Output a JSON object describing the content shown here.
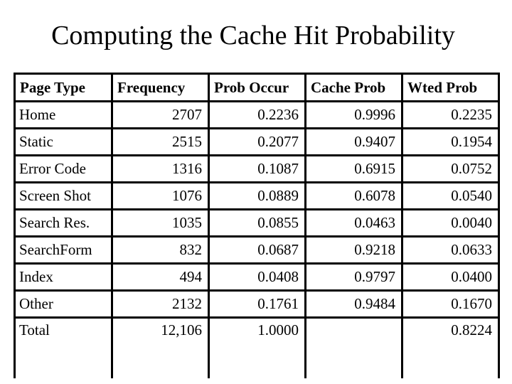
{
  "title": "Computing the Cache Hit Probability",
  "table": {
    "headers": [
      "Page Type",
      "Frequency",
      "Prob Occur",
      "Cache Prob",
      "Wted Prob"
    ],
    "rows": [
      [
        "Home",
        "2707",
        "0.2236",
        "0.9996",
        "0.2235"
      ],
      [
        "Static",
        "2515",
        "0.2077",
        "0.9407",
        "0.1954"
      ],
      [
        "Error Code",
        "1316",
        "0.1087",
        "0.6915",
        "0.0752"
      ],
      [
        "Screen Shot",
        "1076",
        "0.0889",
        "0.6078",
        "0.0540"
      ],
      [
        "Search Res.",
        "1035",
        "0.0855",
        "0.0463",
        "0.0040"
      ],
      [
        "SearchForm",
        "832",
        "0.0687",
        "0.9218",
        "0.0633"
      ],
      [
        "Index",
        "494",
        "0.0408",
        "0.9797",
        "0.0400"
      ],
      [
        "Other",
        "2132",
        "0.1761",
        "0.9484",
        "0.1670"
      ]
    ],
    "total": [
      "Total",
      "12,106",
      "1.0000",
      "",
      "0.8224"
    ]
  }
}
